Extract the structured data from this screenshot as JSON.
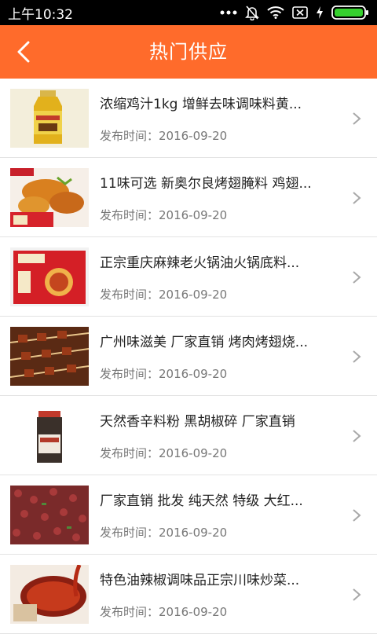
{
  "status_bar": {
    "time": "上午10:32"
  },
  "header": {
    "title": "热门供应",
    "back_icon": "chevron-left-icon"
  },
  "items": [
    {
      "title": "浓缩鸡汁1kg 增鲜去味调味料黄...",
      "date": "发布时间：2016-09-20",
      "image": "chicken-sauce-bottle"
    },
    {
      "title": "11味可选 新奥尔良烤翅腌料 鸡翅...",
      "date": "发布时间：2016-09-20",
      "image": "roasted-wings"
    },
    {
      "title": "正宗重庆麻辣老火锅油火锅底料...",
      "date": "发布时间：2016-09-20",
      "image": "hotpot-base-bag"
    },
    {
      "title": "广州味滋美 厂家直销 烤肉烤翅烧...",
      "date": "发布时间：2016-09-20",
      "image": "meat-skewers"
    },
    {
      "title": "天然香辛料粉 黑胡椒碎 厂家直销",
      "date": "发布时间：2016-09-20",
      "image": "black-pepper-jar"
    },
    {
      "title": "厂家直销 批发 纯天然 特级 大红...",
      "date": "发布时间：2016-09-20",
      "image": "sichuan-peppercorn"
    },
    {
      "title": "特色油辣椒调味品正宗川味炒菜...",
      "date": "发布时间：2016-09-20",
      "image": "chili-oil"
    }
  ],
  "colors": {
    "accent": "#ff6b2b",
    "status_bar": "#000000",
    "divider": "#e3e3e3"
  }
}
